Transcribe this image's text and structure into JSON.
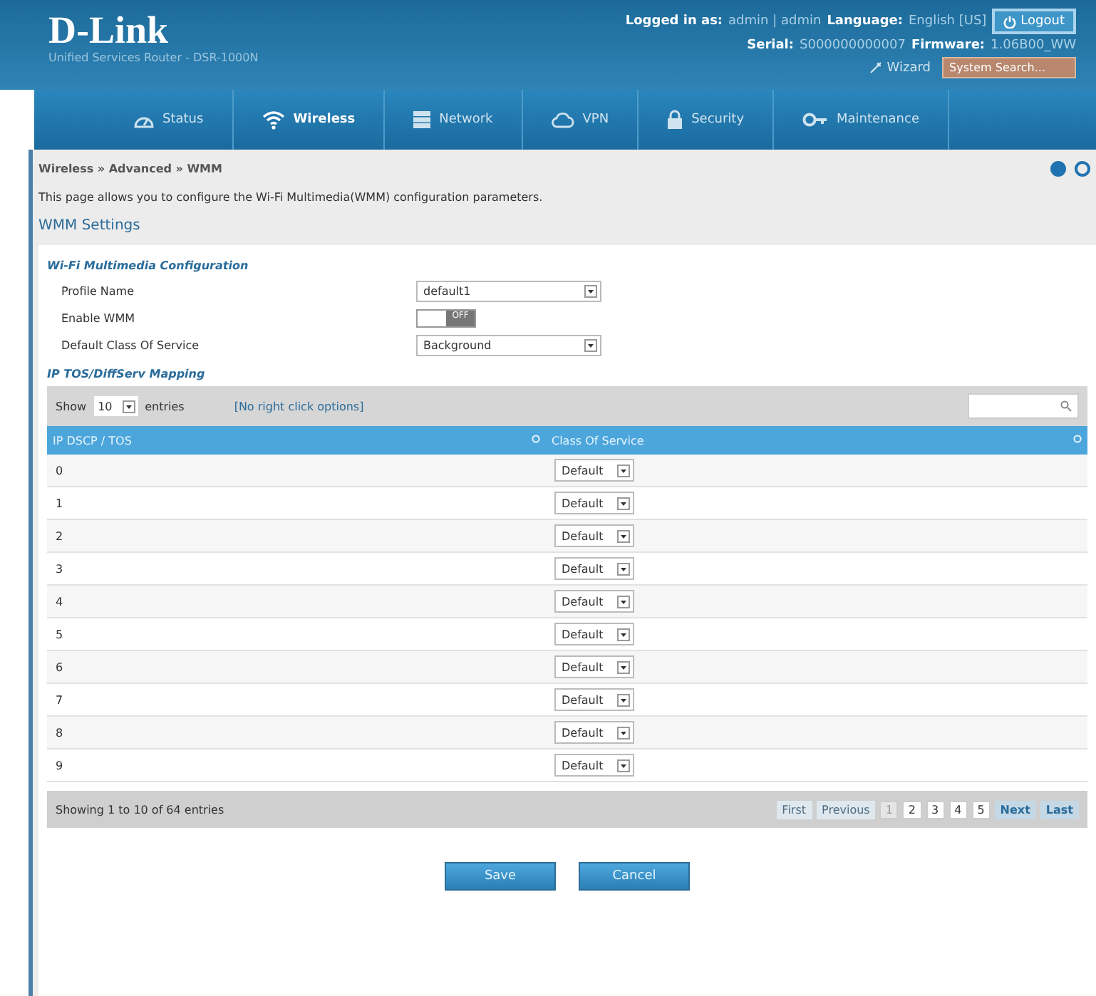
{
  "header": {
    "logo": "D-Link",
    "subtitle": "Unified Services Router - DSR-1000N",
    "logged_in_label": "Logged in as:",
    "user": "admin | admin",
    "language_label": "Language:",
    "language": "English [US]",
    "logout": "Logout",
    "serial_label": "Serial:",
    "serial": "S000000000007",
    "firmware_label": "Firmware:",
    "firmware": "1.06B00_WW",
    "wizard": "Wizard",
    "search": {
      "placeholder": "System Search..."
    }
  },
  "nav": [
    {
      "label": "Status",
      "selected": false
    },
    {
      "label": "Wireless",
      "selected": true
    },
    {
      "label": "Network",
      "selected": false
    },
    {
      "label": "VPN",
      "selected": false
    },
    {
      "label": "Security",
      "selected": false
    },
    {
      "label": "Maintenance",
      "selected": false
    }
  ],
  "breadcrumb": "Wireless » Advanced » WMM",
  "description": "This page allows you to configure the Wi-Fi Multimedia(WMM) configuration parameters.",
  "section_title": "WMM Settings",
  "config": {
    "title": "Wi-Fi Multimedia Configuration",
    "fields": [
      {
        "kind": "select",
        "label": "Profile Name",
        "value": "default1"
      },
      {
        "kind": "toggle",
        "label": "Enable WMM",
        "on": false,
        "state_text": "OFF"
      },
      {
        "kind": "select",
        "label": "Default Class Of Service",
        "value": "Background"
      }
    ]
  },
  "mapping": {
    "title": "IP TOS/DiffServ Mapping",
    "show_label": "Show",
    "page_size": "10",
    "entries_label": "entries",
    "hint": "[No right click options]",
    "columns": [
      "IP DSCP / TOS",
      "Class Of Service"
    ],
    "rows": [
      {
        "tos": "0",
        "cos": "Default"
      },
      {
        "tos": "1",
        "cos": "Default"
      },
      {
        "tos": "2",
        "cos": "Default"
      },
      {
        "tos": "3",
        "cos": "Default"
      },
      {
        "tos": "4",
        "cos": "Default"
      },
      {
        "tos": "5",
        "cos": "Default"
      },
      {
        "tos": "6",
        "cos": "Default"
      },
      {
        "tos": "7",
        "cos": "Default"
      },
      {
        "tos": "8",
        "cos": "Default"
      },
      {
        "tos": "9",
        "cos": "Default"
      }
    ],
    "info": "Showing 1 to 10 of 64 entries",
    "first": {
      "label": "First",
      "disabled": true
    },
    "previous": {
      "label": "Previous",
      "disabled": true
    },
    "pages": [
      {
        "label": "1",
        "selected": true
      },
      {
        "label": "2",
        "selected": false
      },
      {
        "label": "3",
        "selected": false
      },
      {
        "label": "4",
        "selected": false
      },
      {
        "label": "5",
        "selected": false
      }
    ],
    "next": {
      "label": "Next",
      "disabled": false
    },
    "last": {
      "label": "Last",
      "disabled": false
    }
  },
  "buttons": [
    "Save",
    "Cancel"
  ]
}
